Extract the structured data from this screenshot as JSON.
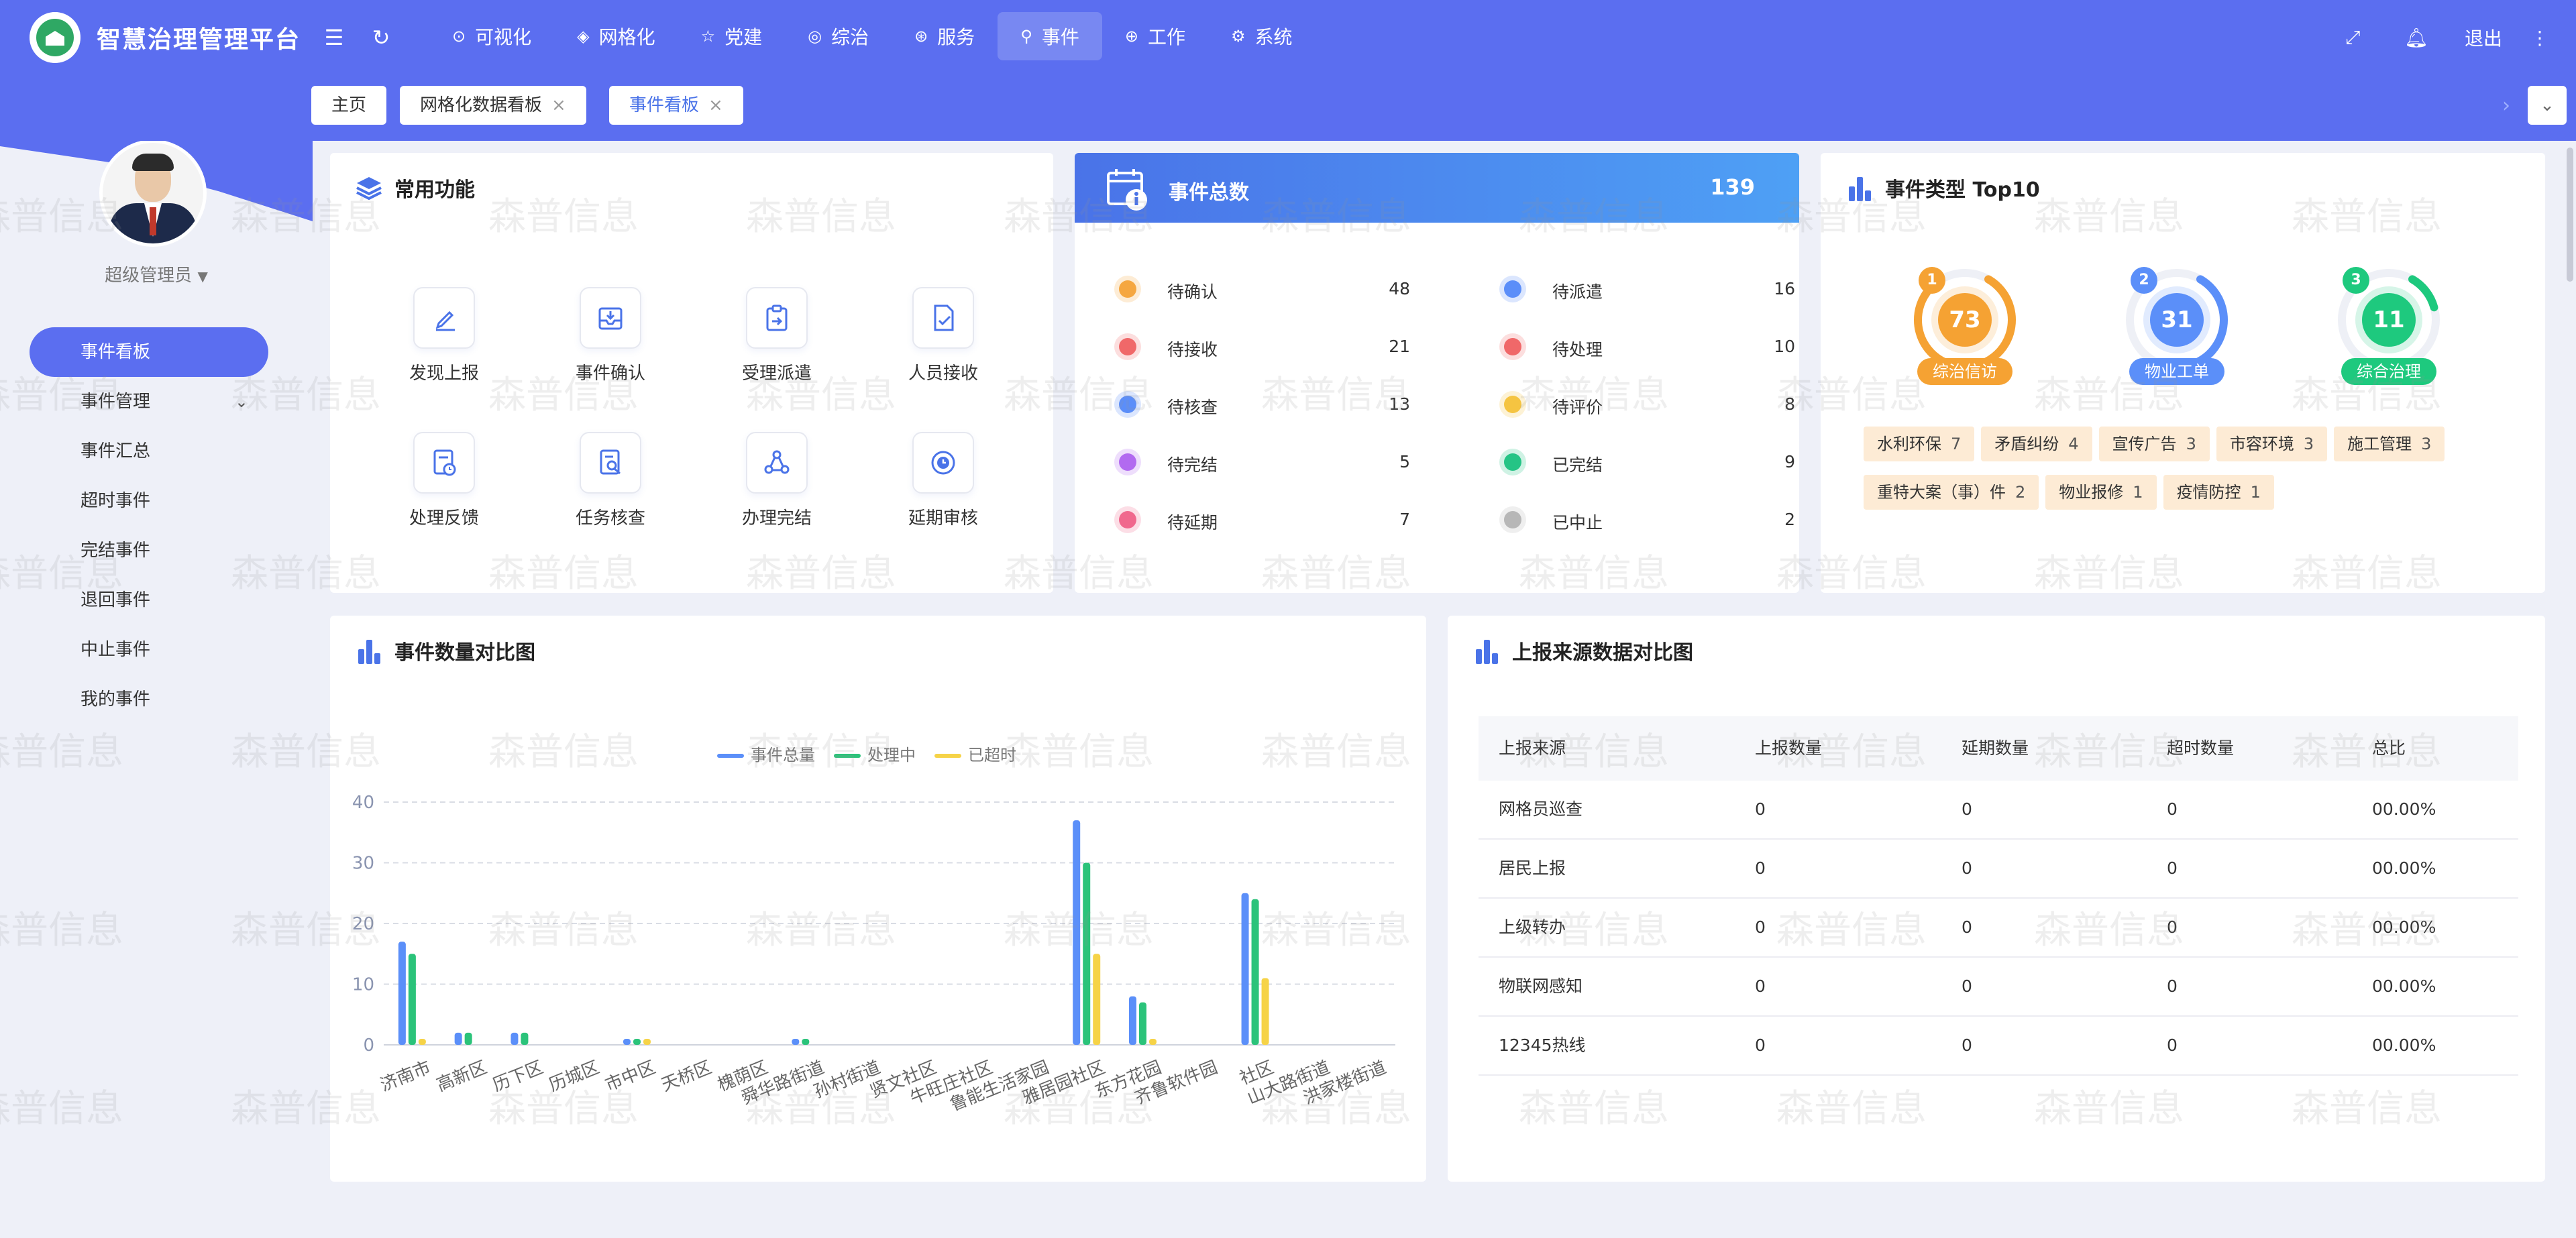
{
  "app": {
    "title": "智慧治理管理平台"
  },
  "topbar": {
    "nav": [
      {
        "label": "可视化",
        "icon": "check-circle-icon"
      },
      {
        "label": "网格化",
        "icon": "grid-icon"
      },
      {
        "label": "党建",
        "icon": "star-icon"
      },
      {
        "label": "综治",
        "icon": "target-icon"
      },
      {
        "label": "服务",
        "icon": "service-icon"
      },
      {
        "label": "事件",
        "icon": "location-pin-icon",
        "active": true
      },
      {
        "label": "工作",
        "icon": "work-icon"
      },
      {
        "label": "系统",
        "icon": "gear-icon"
      }
    ],
    "logout": "退出"
  },
  "tabs": [
    {
      "label": "主页",
      "closable": false
    },
    {
      "label": "网格化数据看板",
      "closable": true
    },
    {
      "label": "事件看板",
      "closable": true,
      "active": true
    }
  ],
  "sidebar": {
    "user": "超级管理员",
    "items": [
      {
        "label": "事件看板",
        "active": true
      },
      {
        "label": "事件管理",
        "expandable": true
      },
      {
        "label": "事件汇总"
      },
      {
        "label": "超时事件"
      },
      {
        "label": "完结事件"
      },
      {
        "label": "退回事件"
      },
      {
        "label": "中止事件"
      },
      {
        "label": "我的事件"
      }
    ]
  },
  "functions": {
    "title": "常用功能",
    "items": [
      {
        "label": "发现上报",
        "icon": "pen-icon"
      },
      {
        "label": "事件确认",
        "icon": "inbox-icon"
      },
      {
        "label": "受理派遣",
        "icon": "clipboard-icon"
      },
      {
        "label": "人员接收",
        "icon": "file-check-icon"
      },
      {
        "label": "处理反馈",
        "icon": "doc-clock-icon"
      },
      {
        "label": "任务核查",
        "icon": "doc-search-icon"
      },
      {
        "label": "办理完结",
        "icon": "share-icon"
      },
      {
        "label": "延期审核",
        "icon": "clock-icon"
      }
    ]
  },
  "events": {
    "title": "事件总数",
    "total": "139",
    "items": [
      {
        "label": "待确认",
        "value": "48",
        "color": "#f5a742"
      },
      {
        "label": "待派遣",
        "value": "16",
        "color": "#5b8ff9"
      },
      {
        "label": "待接收",
        "value": "21",
        "color": "#f0686a"
      },
      {
        "label": "待处理",
        "value": "10",
        "color": "#f0686a"
      },
      {
        "label": "待核查",
        "value": "13",
        "color": "#5b8ff9"
      },
      {
        "label": "待评价",
        "value": "8",
        "color": "#f5c542"
      },
      {
        "label": "待完结",
        "value": "5",
        "color": "#b36bf0"
      },
      {
        "label": "已完结",
        "value": "9",
        "color": "#26c486"
      },
      {
        "label": "待延期",
        "value": "7",
        "color": "#f0688e"
      },
      {
        "label": "已中止",
        "value": "2",
        "color": "#b8b8b8"
      }
    ]
  },
  "top10": {
    "title": "事件类型 Top10",
    "rings": [
      {
        "rank": "1",
        "value": 73,
        "label": "综治信访",
        "color": "#f5a233",
        "max": 73
      },
      {
        "rank": "2",
        "value": 31,
        "label": "物业工单",
        "color": "#5b8ff9",
        "max": 73
      },
      {
        "rank": "3",
        "value": 11,
        "label": "综合治理",
        "color": "#1ec97e",
        "max": 73
      }
    ],
    "chips": [
      {
        "label": "水利环保",
        "count": "7"
      },
      {
        "label": "矛盾纠纷",
        "count": "4"
      },
      {
        "label": "宣传广告",
        "count": "3"
      },
      {
        "label": "市容环境",
        "count": "3"
      },
      {
        "label": "施工管理",
        "count": "3"
      },
      {
        "label": "重特大案（事）件",
        "count": "2"
      },
      {
        "label": "物业报修",
        "count": "1"
      },
      {
        "label": "疫情防控",
        "count": "1"
      }
    ]
  },
  "chart_data": {
    "type": "bar",
    "title": "事件数量对比图",
    "categories": [
      "济南市",
      "高新区",
      "历下区",
      "历城区",
      "市中区",
      "天桥区",
      "槐荫区",
      "舜华路街道",
      "孙村街道",
      "贤文社区",
      "牛旺庄社区",
      "鲁能生活家园",
      "雅居园社区",
      "东方花园",
      "齐鲁软件园",
      "社区",
      "山大路街道",
      "洪家楼街道"
    ],
    "series": [
      {
        "name": "事件总量",
        "color": "#5b8ff9",
        "values": [
          17,
          2,
          2,
          0,
          1,
          0,
          0,
          1,
          0,
          0,
          0,
          0,
          37,
          8,
          0,
          25,
          0,
          0
        ]
      },
      {
        "name": "处理中",
        "color": "#2bc37a",
        "values": [
          15,
          2,
          2,
          0,
          1,
          0,
          0,
          1,
          0,
          0,
          0,
          0,
          30,
          7,
          0,
          24,
          0,
          0
        ]
      },
      {
        "name": "已超时",
        "color": "#f6d347",
        "values": [
          1,
          0,
          0,
          0,
          1,
          0,
          0,
          0,
          0,
          0,
          0,
          0,
          15,
          1,
          0,
          11,
          0,
          0
        ]
      }
    ],
    "ylim": [
      0,
      40
    ],
    "yticks": [
      0,
      10,
      20,
      30,
      40
    ],
    "grid": true,
    "legend": "top-center"
  },
  "sources": {
    "title": "上报来源数据对比图",
    "columns": [
      "上报来源",
      "上报数量",
      "延期数量",
      "超时数量",
      "总比"
    ],
    "rows": [
      [
        "网格员巡查",
        "0",
        "0",
        "0",
        "00.00%"
      ],
      [
        "居民上报",
        "0",
        "0",
        "0",
        "00.00%"
      ],
      [
        "上级转办",
        "0",
        "0",
        "0",
        "00.00%"
      ],
      [
        "物联网感知",
        "0",
        "0",
        "0",
        "00.00%"
      ],
      [
        "12345热线",
        "0",
        "0",
        "0",
        "00.00%"
      ]
    ]
  },
  "watermark": {
    "text": "森普信息"
  }
}
